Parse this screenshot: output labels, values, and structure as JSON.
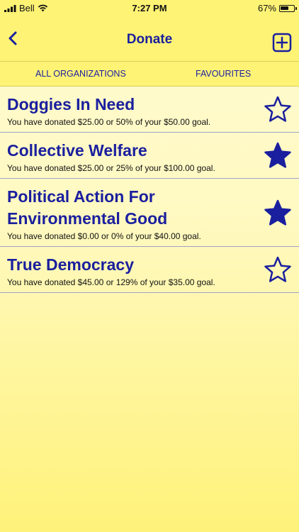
{
  "status": {
    "carrier": "Bell",
    "time": "7:27 PM",
    "battery_percent": "67%",
    "battery_level": 0.67
  },
  "nav": {
    "title": "Donate",
    "back_icon": "chevron-left-icon",
    "add_icon": "plus-square-icon"
  },
  "tabs": [
    {
      "label": "ALL ORGANIZATIONS"
    },
    {
      "label": "FAVOURITES"
    }
  ],
  "organizations": [
    {
      "name": "Doggies In Need",
      "summary": "You have donated $25.00 or 50% of your $50.00 goal.",
      "favourite": false
    },
    {
      "name": "Collective Welfare",
      "summary": "You have donated $25.00 or 25% of your $100.00 goal.",
      "favourite": true
    },
    {
      "name": "Political Action For Environmental Good",
      "summary": "You have donated $0.00 or 0% of your $40.00 goal.",
      "favourite": true
    },
    {
      "name": "True Democracy",
      "summary": "You have donated $45.00 or 129% of your $35.00 goal.",
      "favourite": false
    }
  ],
  "colors": {
    "accent": "#1a1f9e",
    "bar": "#fff376"
  }
}
